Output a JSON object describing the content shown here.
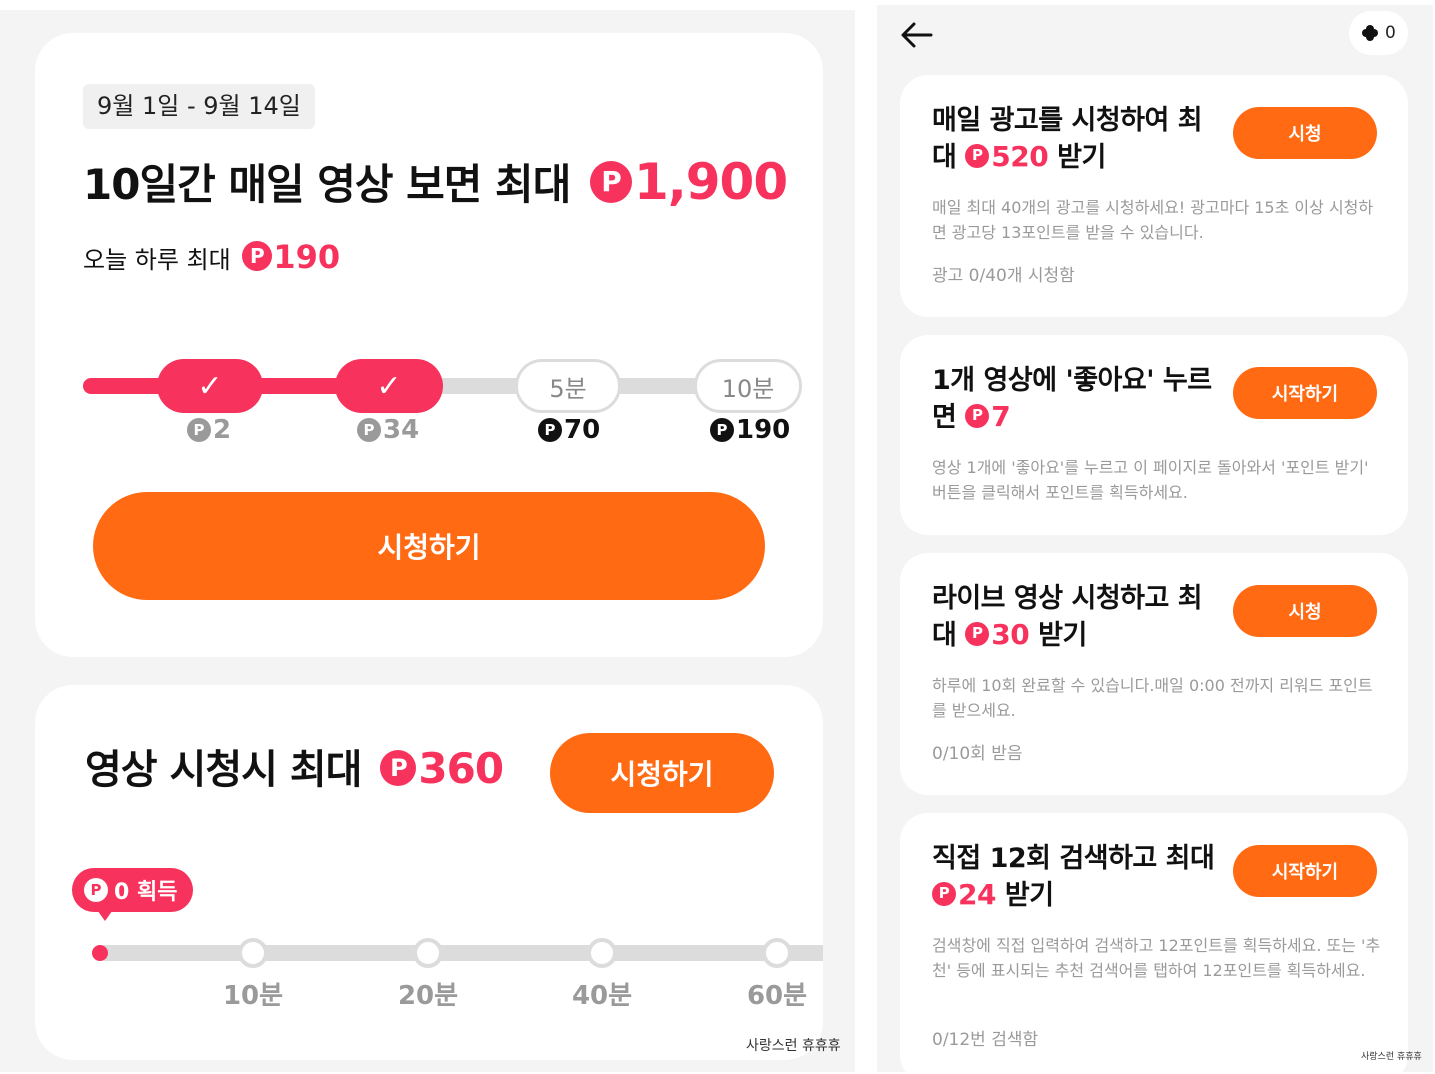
{
  "colors": {
    "accent_pink": "#f7325c",
    "accent_orange": "#ff6a13",
    "track_grey": "#dcdcdc"
  },
  "left": {
    "card1": {
      "date_range": "9월 1일 - 9월 14일",
      "headline_text": "10일간 매일 영상 보면 최대",
      "headline_amount": "1,900",
      "today_text": "오늘 하루 최대",
      "today_amount": "190",
      "milestones": [
        {
          "label": "✓",
          "reward": "2",
          "completed": true
        },
        {
          "label": "✓",
          "reward": "34",
          "completed": true
        },
        {
          "label": "5분",
          "reward": "70",
          "completed": false
        },
        {
          "label": "10분",
          "reward": "190",
          "completed": false
        }
      ],
      "watch_button": "시청하기"
    },
    "card2": {
      "headline_text": "영상 시청시 최대",
      "headline_amount": "360",
      "watch_button": "시청하기",
      "earned_badge": "0 획득",
      "progress_fraction": 0,
      "ticks": [
        "10분",
        "20분",
        "40분",
        "60분"
      ]
    },
    "watermark": "사랑스런 휴휴휴"
  },
  "right": {
    "point_count": "0",
    "tasks": [
      {
        "title_pre": "매일 광고를 시청하여 최대 ",
        "amount": "520",
        "title_post": " 받기",
        "button": "시청",
        "description": "매일 최대 40개의 광고를 시청하세요! 광고마다 15초 이상 시청하면 광고당 13포인트를 받을 수 있습니다.",
        "status": "광고 0/40개 시청함"
      },
      {
        "title_pre": "1개 영상에 '좋아요' 누르면 ",
        "amount": "7",
        "title_post": "",
        "button": "시작하기",
        "description": "영상 1개에 '좋아요'를 누르고 이 페이지로 돌아와서 '포인트 받기' 버튼을 클릭해서 포인트를 획득하세요.",
        "status": ""
      },
      {
        "title_pre": "라이브 영상 시청하고 최대 ",
        "amount": "30",
        "title_post": " 받기",
        "button": "시청",
        "description": "하루에 10회 완료할 수 있습니다.매일 0:00 전까지 리워드 포인트를 받으세요.",
        "status": "0/10회 받음"
      },
      {
        "title_pre": "직접 12회 검색하고 최대 ",
        "amount": "24",
        "title_post": " 받기",
        "button": "시작하기",
        "description": "검색창에 직접 입력하여 검색하고 12포인트를 획득하세요. 또는 '추천' 등에 표시되는 추천 검색어를 탭하여 12포인트를 획득하세요.",
        "status": "0/12번 검색함"
      }
    ],
    "watermark": "사랑스런 휴휴휴"
  }
}
